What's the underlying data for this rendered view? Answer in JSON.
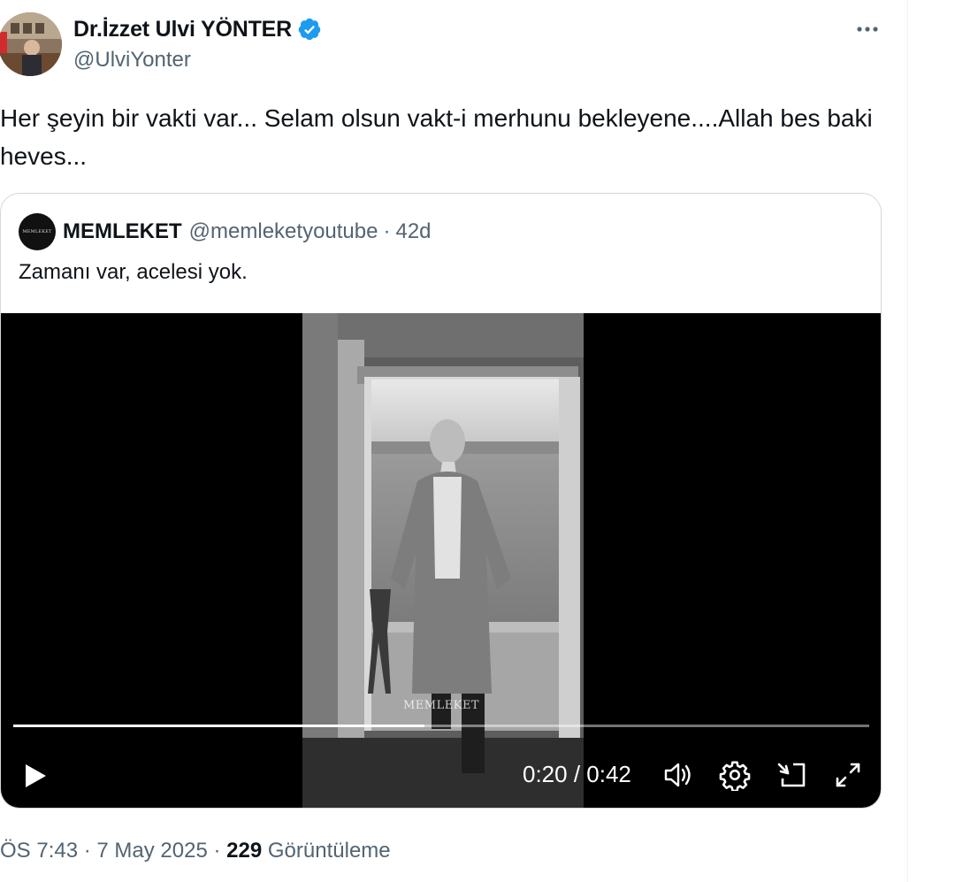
{
  "author": {
    "display_name": "Dr.İzzet Ulvi YÖNTER",
    "handle": "@UlviYonter",
    "verified": true,
    "verified_color": "#1d9bf0"
  },
  "tweet": {
    "text": "Her şeyin bir vakti var... Selam olsun vakt-i merhunu bekleyene....Allah bes baki heves..."
  },
  "quote": {
    "avatar_text": "MEMLEKET",
    "name": "MEMLEKET",
    "handle": "@memleketyoutube",
    "separator": "·",
    "time": "42d",
    "text": "Zamanı var, acelesi yok."
  },
  "video": {
    "watermark": "MEMLEKET",
    "time_display": "0:20 / 0:42",
    "progress": 0.48,
    "controls": [
      "play-icon",
      "volume-icon",
      "gear-icon",
      "pip-icon",
      "fullscreen-icon"
    ]
  },
  "meta": {
    "time": "ÖS 7:43",
    "separator": "·",
    "date": "7 May 2025",
    "views_count": "229",
    "views_label": "Görüntüleme"
  },
  "colors": {
    "text": "#0f1419",
    "secondary": "#536471",
    "border": "#cfd9de"
  }
}
